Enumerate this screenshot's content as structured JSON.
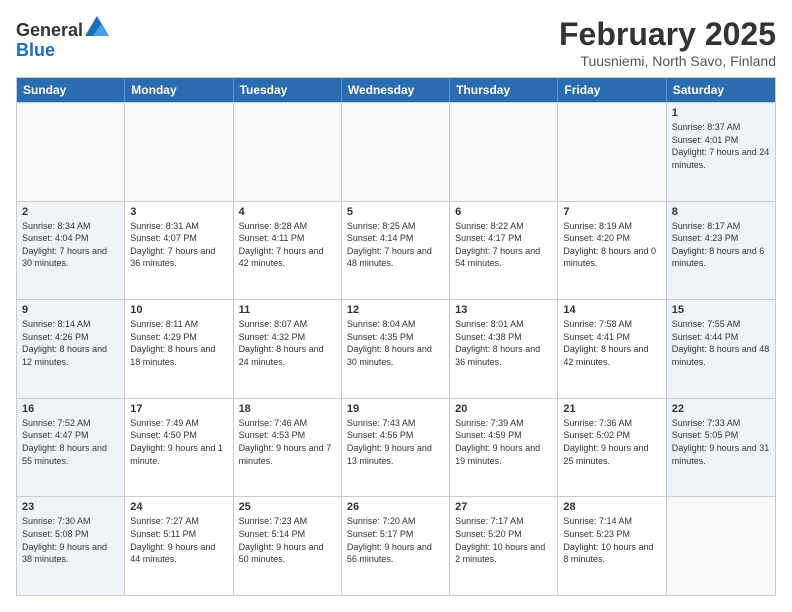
{
  "logo": {
    "general": "General",
    "blue": "Blue"
  },
  "title": "February 2025",
  "subtitle": "Tuusniemi, North Savo, Finland",
  "days": [
    "Sunday",
    "Monday",
    "Tuesday",
    "Wednesday",
    "Thursday",
    "Friday",
    "Saturday"
  ],
  "weeks": [
    [
      {
        "day": "",
        "info": ""
      },
      {
        "day": "",
        "info": ""
      },
      {
        "day": "",
        "info": ""
      },
      {
        "day": "",
        "info": ""
      },
      {
        "day": "",
        "info": ""
      },
      {
        "day": "",
        "info": ""
      },
      {
        "day": "1",
        "info": "Sunrise: 8:37 AM\nSunset: 4:01 PM\nDaylight: 7 hours\nand 24 minutes."
      }
    ],
    [
      {
        "day": "2",
        "info": "Sunrise: 8:34 AM\nSunset: 4:04 PM\nDaylight: 7 hours\nand 30 minutes."
      },
      {
        "day": "3",
        "info": "Sunrise: 8:31 AM\nSunset: 4:07 PM\nDaylight: 7 hours\nand 36 minutes."
      },
      {
        "day": "4",
        "info": "Sunrise: 8:28 AM\nSunset: 4:11 PM\nDaylight: 7 hours\nand 42 minutes."
      },
      {
        "day": "5",
        "info": "Sunrise: 8:25 AM\nSunset: 4:14 PM\nDaylight: 7 hours\nand 48 minutes."
      },
      {
        "day": "6",
        "info": "Sunrise: 8:22 AM\nSunset: 4:17 PM\nDaylight: 7 hours\nand 54 minutes."
      },
      {
        "day": "7",
        "info": "Sunrise: 8:19 AM\nSunset: 4:20 PM\nDaylight: 8 hours\nand 0 minutes."
      },
      {
        "day": "8",
        "info": "Sunrise: 8:17 AM\nSunset: 4:23 PM\nDaylight: 8 hours\nand 6 minutes."
      }
    ],
    [
      {
        "day": "9",
        "info": "Sunrise: 8:14 AM\nSunset: 4:26 PM\nDaylight: 8 hours\nand 12 minutes."
      },
      {
        "day": "10",
        "info": "Sunrise: 8:11 AM\nSunset: 4:29 PM\nDaylight: 8 hours\nand 18 minutes."
      },
      {
        "day": "11",
        "info": "Sunrise: 8:07 AM\nSunset: 4:32 PM\nDaylight: 8 hours\nand 24 minutes."
      },
      {
        "day": "12",
        "info": "Sunrise: 8:04 AM\nSunset: 4:35 PM\nDaylight: 8 hours\nand 30 minutes."
      },
      {
        "day": "13",
        "info": "Sunrise: 8:01 AM\nSunset: 4:38 PM\nDaylight: 8 hours\nand 36 minutes."
      },
      {
        "day": "14",
        "info": "Sunrise: 7:58 AM\nSunset: 4:41 PM\nDaylight: 8 hours\nand 42 minutes."
      },
      {
        "day": "15",
        "info": "Sunrise: 7:55 AM\nSunset: 4:44 PM\nDaylight: 8 hours\nand 48 minutes."
      }
    ],
    [
      {
        "day": "16",
        "info": "Sunrise: 7:52 AM\nSunset: 4:47 PM\nDaylight: 8 hours\nand 55 minutes."
      },
      {
        "day": "17",
        "info": "Sunrise: 7:49 AM\nSunset: 4:50 PM\nDaylight: 9 hours\nand 1 minute."
      },
      {
        "day": "18",
        "info": "Sunrise: 7:46 AM\nSunset: 4:53 PM\nDaylight: 9 hours\nand 7 minutes."
      },
      {
        "day": "19",
        "info": "Sunrise: 7:43 AM\nSunset: 4:56 PM\nDaylight: 9 hours\nand 13 minutes."
      },
      {
        "day": "20",
        "info": "Sunrise: 7:39 AM\nSunset: 4:59 PM\nDaylight: 9 hours\nand 19 minutes."
      },
      {
        "day": "21",
        "info": "Sunrise: 7:36 AM\nSunset: 5:02 PM\nDaylight: 9 hours\nand 25 minutes."
      },
      {
        "day": "22",
        "info": "Sunrise: 7:33 AM\nSunset: 5:05 PM\nDaylight: 9 hours\nand 31 minutes."
      }
    ],
    [
      {
        "day": "23",
        "info": "Sunrise: 7:30 AM\nSunset: 5:08 PM\nDaylight: 9 hours\nand 38 minutes."
      },
      {
        "day": "24",
        "info": "Sunrise: 7:27 AM\nSunset: 5:11 PM\nDaylight: 9 hours\nand 44 minutes."
      },
      {
        "day": "25",
        "info": "Sunrise: 7:23 AM\nSunset: 5:14 PM\nDaylight: 9 hours\nand 50 minutes."
      },
      {
        "day": "26",
        "info": "Sunrise: 7:20 AM\nSunset: 5:17 PM\nDaylight: 9 hours\nand 56 minutes."
      },
      {
        "day": "27",
        "info": "Sunrise: 7:17 AM\nSunset: 5:20 PM\nDaylight: 10 hours\nand 2 minutes."
      },
      {
        "day": "28",
        "info": "Sunrise: 7:14 AM\nSunset: 5:23 PM\nDaylight: 10 hours\nand 8 minutes."
      },
      {
        "day": "",
        "info": ""
      }
    ]
  ]
}
